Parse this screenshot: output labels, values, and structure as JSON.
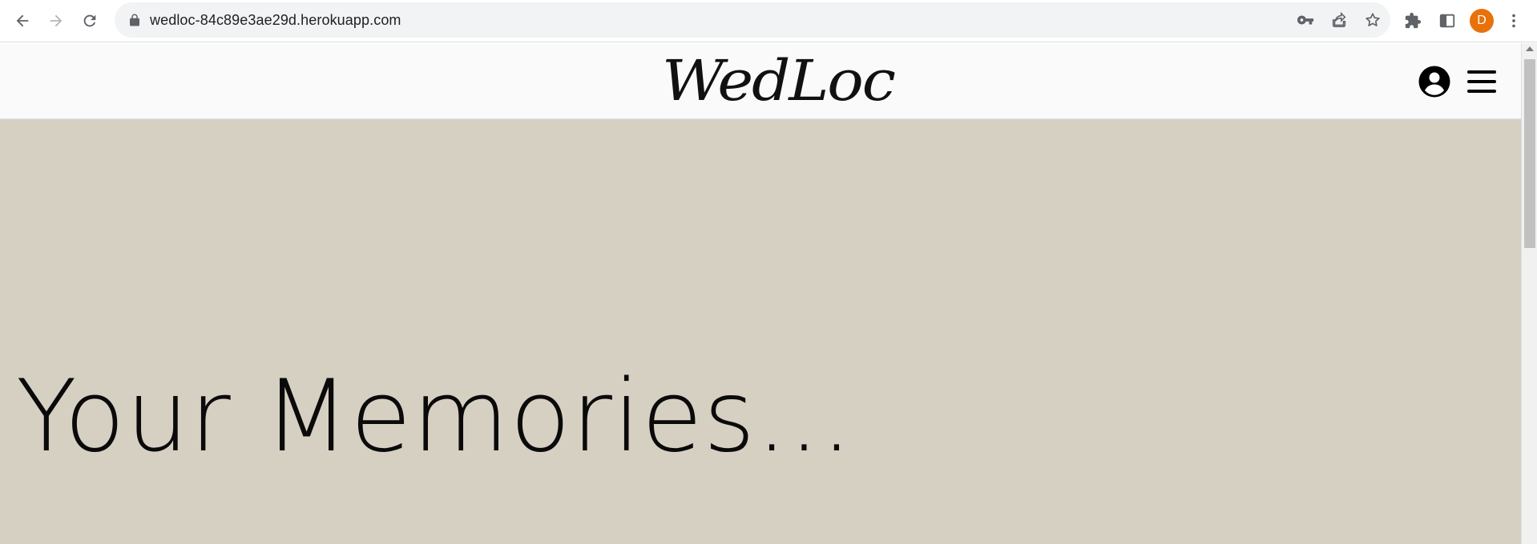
{
  "browser": {
    "url": "wedloc-84c89e3ae29d.herokuapp.com",
    "profile_initial": "D",
    "icons": {
      "back": "arrow-left-icon",
      "forward": "arrow-right-icon",
      "reload": "reload-icon",
      "lock": "lock-icon",
      "password": "key-icon",
      "share": "share-icon",
      "bookmark": "star-icon",
      "extensions": "puzzle-icon",
      "side_panel": "side-panel-icon",
      "menu": "kebab-menu-icon"
    },
    "colors": {
      "profile": "#e8710a",
      "omnibox": "#f1f3f4"
    }
  },
  "site": {
    "logo_text": "WedLoc",
    "header_icons": {
      "account": "account-circle-icon",
      "menu": "hamburger-menu-icon"
    },
    "hero": {
      "title": "Your Memories..."
    },
    "colors": {
      "header_bg": "#fafafa",
      "hero_bg": "#d6d0c3",
      "text": "#0a0a0a"
    }
  }
}
